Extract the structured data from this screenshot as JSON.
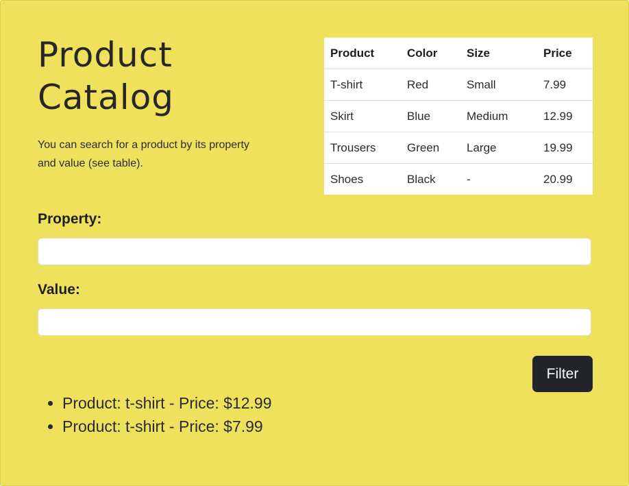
{
  "header": {
    "title": "Product Catalog",
    "description": "You can search for a product by its property and value (see table)."
  },
  "table": {
    "columns": [
      "Product",
      "Color",
      "Size",
      "Price"
    ],
    "rows": [
      [
        "T-shirt",
        "Red",
        "Small",
        "7.99"
      ],
      [
        "Skirt",
        "Blue",
        "Medium",
        "12.99"
      ],
      [
        "Trousers",
        "Green",
        "Large",
        "19.99"
      ],
      [
        "Shoes",
        "Black",
        "-",
        "20.99"
      ]
    ]
  },
  "form": {
    "property_label": "Property:",
    "property_value": "",
    "value_label": "Value:",
    "value_value": "",
    "filter_label": "Filter"
  },
  "results": [
    "Product: t-shirt - Price: $12.99",
    "Product: t-shirt - Price: $7.99"
  ],
  "colors": {
    "background": "#efe15c",
    "button": "#212529",
    "button_text": "#ffffff"
  }
}
